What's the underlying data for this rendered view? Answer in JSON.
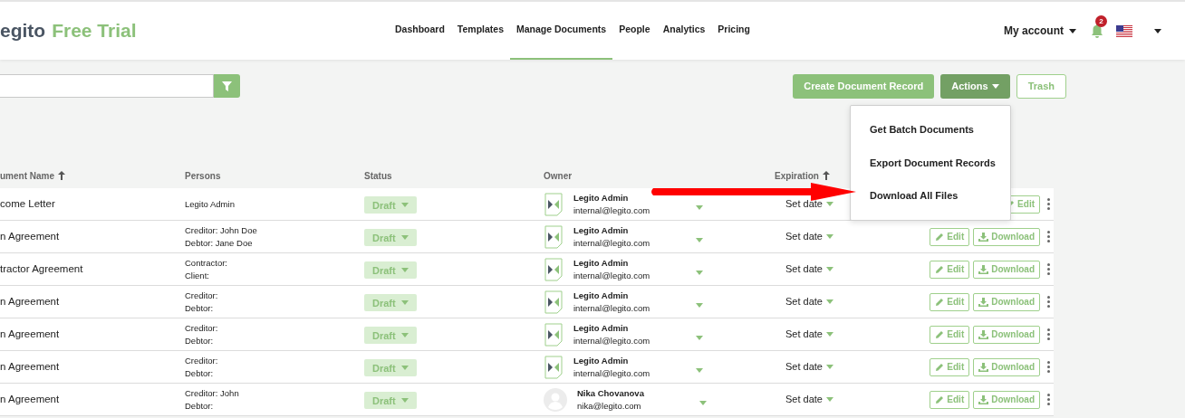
{
  "brand": {
    "name": "egito",
    "suffix": "Free Trial"
  },
  "nav": [
    {
      "label": "Dashboard",
      "selected": false
    },
    {
      "label": "Templates",
      "selected": false
    },
    {
      "label": "Manage Documents",
      "selected": true
    },
    {
      "label": "People",
      "selected": false
    },
    {
      "label": "Analytics",
      "selected": false
    },
    {
      "label": "Pricing",
      "selected": false
    }
  ],
  "account": {
    "label": "My account",
    "notifications": "2"
  },
  "toolbar": {
    "create": "Create Document Record",
    "actions": "Actions",
    "trash": "Trash"
  },
  "actions_menu": [
    "Get Batch Documents",
    "Export Document Records",
    "Download All Files"
  ],
  "table": {
    "columns": [
      "ument Name",
      "Persons",
      "Status",
      "Owner",
      "Expiration"
    ],
    "rows": [
      {
        "name": "come Letter",
        "persons": [
          "Legito Admin"
        ],
        "status": "Draft",
        "owner": {
          "kind": "logo",
          "name": "Legito Admin",
          "email": "internal@legito.com"
        },
        "expiration": "Set date",
        "actions": [
          "Edit"
        ]
      },
      {
        "name": "n Agreement",
        "persons": [
          "Creditor: John Doe",
          "Debtor: Jane Doe"
        ],
        "status": "Draft",
        "owner": {
          "kind": "logo",
          "name": "Legito Admin",
          "email": "internal@legito.com"
        },
        "expiration": "Set date",
        "actions": [
          "Edit",
          "Download"
        ]
      },
      {
        "name": "tractor Agreement",
        "persons": [
          "Contractor:",
          "Client:"
        ],
        "status": "Draft",
        "owner": {
          "kind": "logo",
          "name": "Legito Admin",
          "email": "internal@legito.com"
        },
        "expiration": "Set date",
        "actions": [
          "Edit",
          "Download"
        ]
      },
      {
        "name": "n Agreement",
        "persons": [
          "Creditor:",
          "Debtor:"
        ],
        "status": "Draft",
        "owner": {
          "kind": "logo",
          "name": "Legito Admin",
          "email": "internal@legito.com"
        },
        "expiration": "Set date",
        "actions": [
          "Edit",
          "Download"
        ]
      },
      {
        "name": "n Agreement",
        "persons": [
          "Creditor:",
          "Debtor:"
        ],
        "status": "Draft",
        "owner": {
          "kind": "logo",
          "name": "Legito Admin",
          "email": "internal@legito.com"
        },
        "expiration": "Set date",
        "actions": [
          "Edit",
          "Download"
        ]
      },
      {
        "name": "n Agreement",
        "persons": [
          "Creditor:",
          "Debtor:"
        ],
        "status": "Draft",
        "owner": {
          "kind": "logo",
          "name": "Legito Admin",
          "email": "internal@legito.com"
        },
        "expiration": "Set date",
        "actions": [
          "Edit",
          "Download"
        ]
      },
      {
        "name": "n Agreement",
        "persons": [
          "Creditor: John",
          "Debtor:"
        ],
        "status": "Draft",
        "owner": {
          "kind": "person",
          "name": "Nika Chovanova",
          "email": "nika@legito.com"
        },
        "expiration": "Set date",
        "actions": [
          "Edit",
          "Download"
        ]
      }
    ]
  }
}
